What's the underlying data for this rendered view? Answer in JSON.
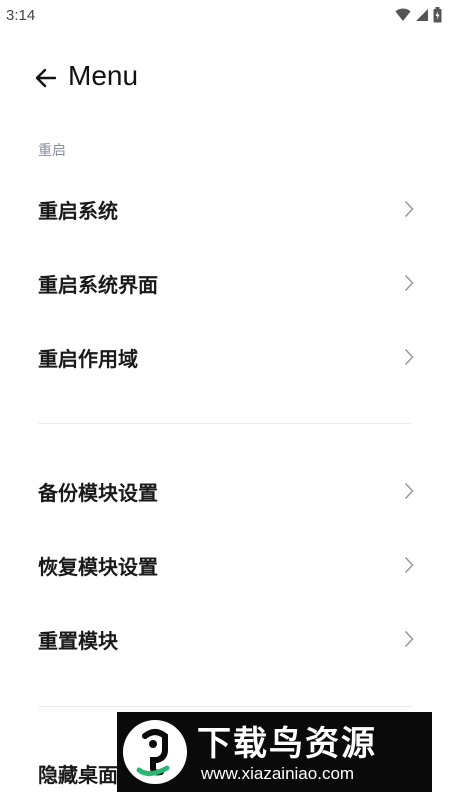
{
  "status_bar": {
    "time": "3:14"
  },
  "app_bar": {
    "title": "Menu"
  },
  "sections": [
    {
      "header": "重启",
      "items": [
        {
          "label": "重启系统"
        },
        {
          "label": "重启系统界面"
        },
        {
          "label": "重启作用域"
        }
      ]
    },
    {
      "header": "",
      "items": [
        {
          "label": "备份模块设置"
        },
        {
          "label": "恢复模块设置"
        },
        {
          "label": "重置模块"
        }
      ]
    },
    {
      "header": "",
      "items": [
        {
          "label": "隐藏桌面"
        }
      ]
    }
  ],
  "watermark": {
    "title": "下载鸟资源",
    "url": "www.xiazainiao.com"
  },
  "colors": {
    "accent_text": "#1a1a1a",
    "section_header": "#8a8fa0",
    "divider": "#ececec"
  }
}
